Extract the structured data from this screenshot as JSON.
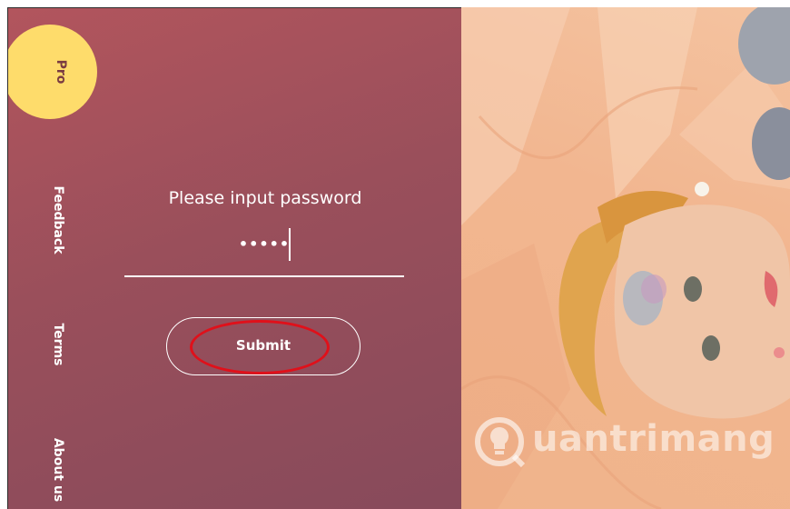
{
  "nav": {
    "pro_label": "Pro",
    "feedback_label": "Feedback",
    "terms_label": "Terms",
    "about_label": "About us"
  },
  "form": {
    "prompt": "Please input password",
    "password_value": "•••••",
    "submit_label": "Submit"
  },
  "watermark": {
    "text": "uantrimang"
  },
  "colors": {
    "panel_top": "#b2555d",
    "panel_bottom": "#874a5b",
    "pro_badge": "#fedc6b",
    "highlight": "#e0101a",
    "photo_bg": "#f2b690"
  }
}
